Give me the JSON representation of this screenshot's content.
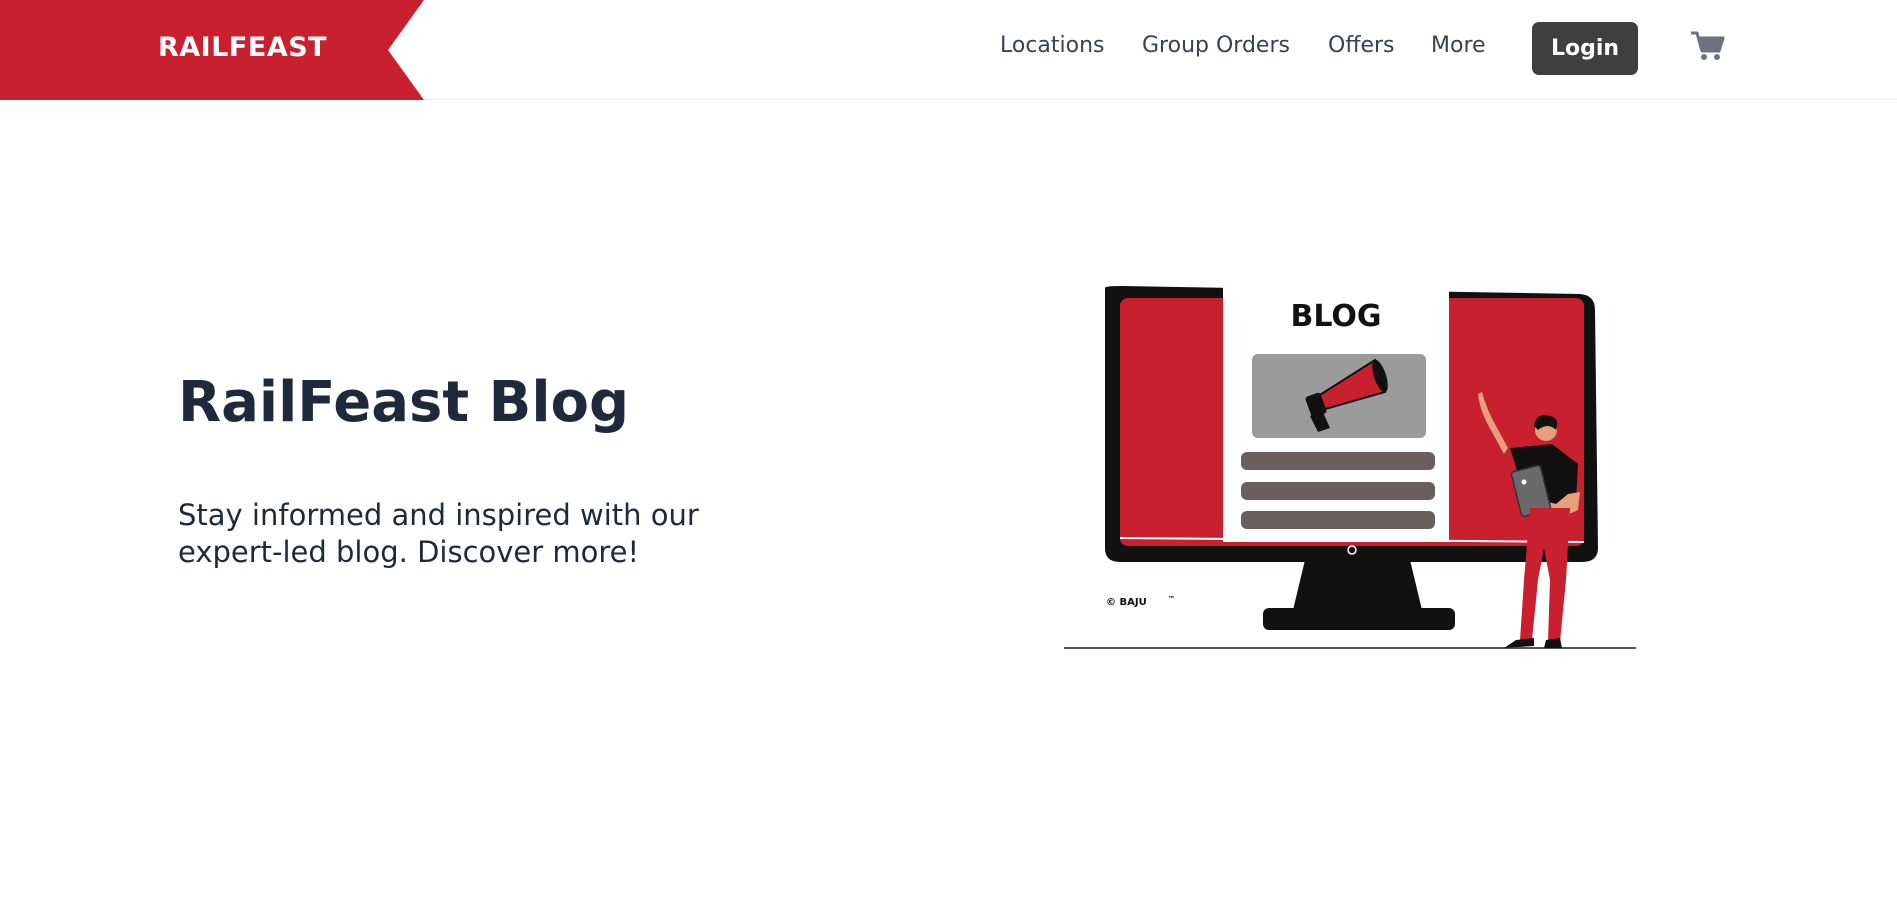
{
  "header": {
    "logo_text": "RAILFEAST",
    "nav": [
      "Locations",
      "Group Orders",
      "Offers",
      "More"
    ],
    "login_label": "Login",
    "cart_icon": "cart-icon"
  },
  "hero": {
    "title": "RailFeast Blog",
    "subtitle": "Stay informed and inspired with our expert-led blog. Discover more!"
  },
  "illustration": {
    "screen_label": "BLOG",
    "credit": "© BAJU",
    "trademark": "™"
  },
  "colors": {
    "brand_red": "#c9202f",
    "dark_button": "#3f3f3f",
    "heading": "#1e293b",
    "nav_text": "#374151"
  }
}
